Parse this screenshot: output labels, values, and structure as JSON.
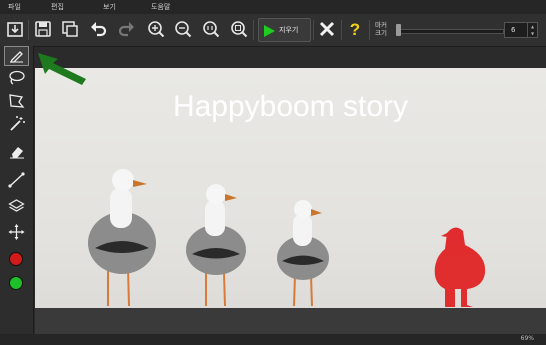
{
  "menu": {
    "file": "파일",
    "edit": "편집",
    "view": "보기",
    "help": "도움말"
  },
  "toolbar": {
    "icons": [
      "import-icon",
      "save-icon",
      "duplicate-icon",
      "undo-icon",
      "redo-icon",
      "zoom-in-icon",
      "zoom-out-icon",
      "zoom-actual-icon",
      "zoom-fit-icon",
      "play-icon",
      "close-icon",
      "help-icon"
    ],
    "erase_label": "지우기",
    "size_label_top": "마커",
    "size_label_bottom": "크기",
    "size_value": "6",
    "size_level": 0.0
  },
  "sidebar": {
    "tools": [
      "pencil-icon",
      "lasso-icon",
      "polygon-lasso-icon",
      "magic-wand-icon",
      "eraser-icon",
      "line-icon",
      "layers-icon",
      "move-icon"
    ],
    "colors": {
      "keep": "#d11a1a",
      "remove": "#1fbf2a"
    }
  },
  "canvas": {
    "title": "Happyboom story"
  },
  "status": {
    "zoom": "69%"
  },
  "colors": {
    "accent_arrow": "#1f7a1f",
    "mask_gray": "#8c8c8c",
    "mask_red": "#e0191b"
  }
}
